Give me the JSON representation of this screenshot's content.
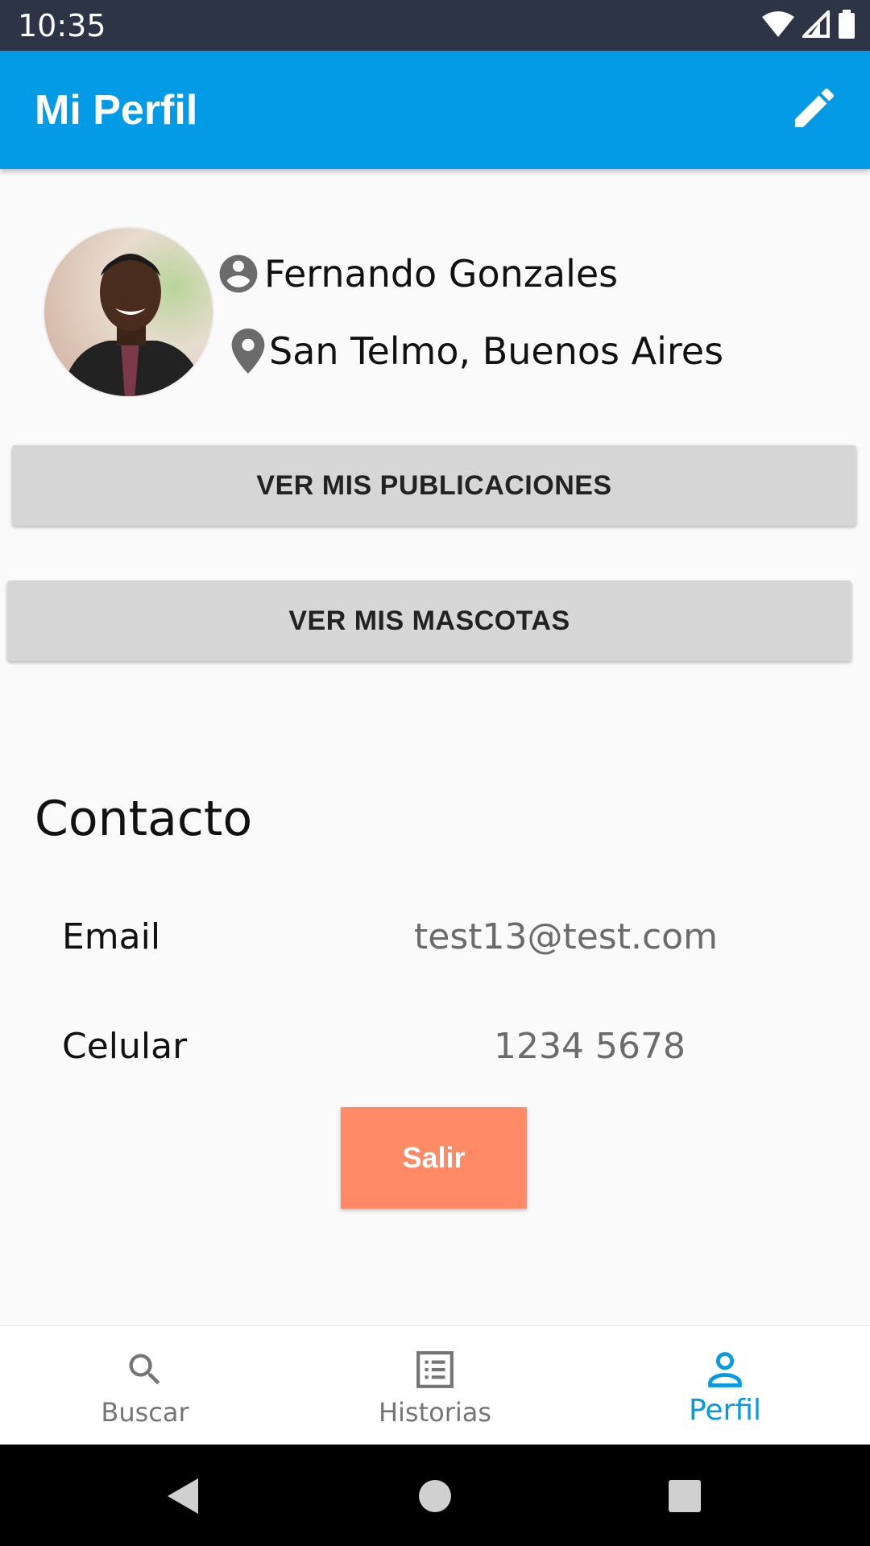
{
  "status_bar": {
    "time": "10:35"
  },
  "app_bar": {
    "title": "Mi Perfil"
  },
  "profile": {
    "name": "Fernando Gonzales",
    "location": "San Telmo, Buenos Aires"
  },
  "buttons": {
    "publications": "VER MIS PUBLICACIONES",
    "pets": "VER MIS MASCOTAS",
    "logout": "Salir"
  },
  "contact": {
    "title": "Contacto",
    "email_label": "Email",
    "email_value": "test13@test.com",
    "phone_label": "Celular",
    "phone_value": "1234 5678"
  },
  "bottom_nav": {
    "items": [
      {
        "label": "Buscar",
        "icon": "search-icon",
        "active": false
      },
      {
        "label": "Historias",
        "icon": "list-icon",
        "active": false
      },
      {
        "label": "Perfil",
        "icon": "person-icon",
        "active": true
      }
    ]
  },
  "colors": {
    "primary": "#039be5",
    "logout": "#ff8a65",
    "status_bar": "#2c3446"
  }
}
